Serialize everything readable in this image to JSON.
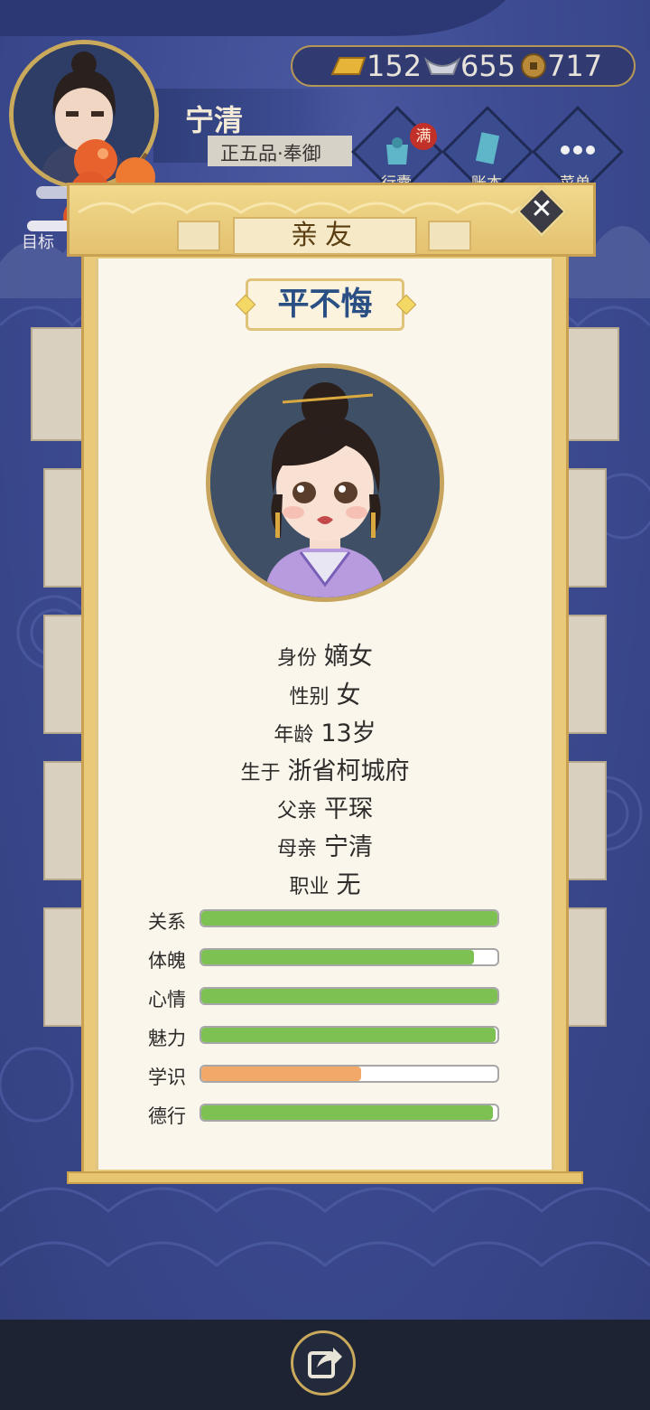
{
  "hud": {
    "player_name": "宁清",
    "player_rank": "正五品·奉御",
    "currency": [
      {
        "icon": "gold-bar-icon",
        "value": "152"
      },
      {
        "icon": "silver-ingot-icon",
        "value": "655"
      },
      {
        "icon": "copper-coin-icon",
        "value": "717"
      }
    ],
    "buttons": [
      {
        "label": "行囊",
        "badge": "满",
        "icon": "bag-icon"
      },
      {
        "label": "账本",
        "icon": "ledger-icon"
      },
      {
        "label": "菜单",
        "icon": "more-icon"
      }
    ],
    "goal_label": "目标"
  },
  "dialog": {
    "title": "亲友",
    "character_name": "平不悔",
    "info": [
      {
        "label": "身份",
        "value": "嫡女"
      },
      {
        "label": "性别",
        "value": "女"
      },
      {
        "label": "年龄",
        "value": "13岁"
      },
      {
        "label": "生于",
        "value": "浙省柯城府"
      },
      {
        "label": "父亲",
        "value": "平琛"
      },
      {
        "label": "母亲",
        "value": "宁清"
      },
      {
        "label": "职业",
        "value": "无"
      }
    ],
    "stats": [
      {
        "label": "关系",
        "fraction": 1.0,
        "color": "#7cc152"
      },
      {
        "label": "体魄",
        "fraction": 0.92,
        "color": "#7cc152"
      },
      {
        "label": "心情",
        "fraction": 1.0,
        "color": "#7cc152"
      },
      {
        "label": "魅力",
        "fraction": 0.995,
        "color": "#7cc152"
      },
      {
        "label": "学识",
        "fraction": 0.54,
        "color": "#f2a868"
      },
      {
        "label": "德行",
        "fraction": 0.985,
        "color": "#7cc152"
      }
    ]
  }
}
